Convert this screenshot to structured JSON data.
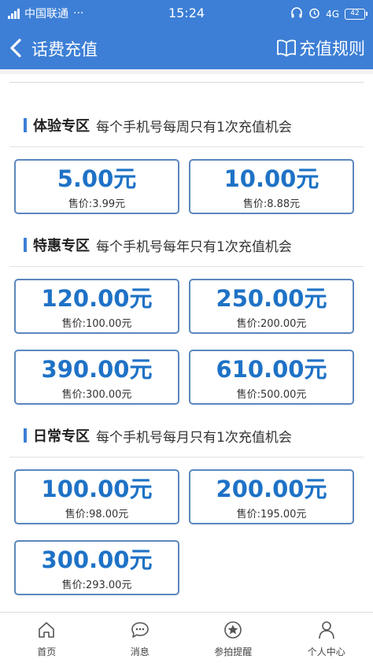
{
  "status_bar": {
    "carrier": "中国联通",
    "dots": "···",
    "time": "15:24",
    "network": "4G",
    "battery": "42"
  },
  "header": {
    "title": "话费充值",
    "rules_label": "充值规则",
    "color": "#3d7fd6"
  },
  "sections": [
    {
      "name": "体验专区",
      "desc": "每个手机号每周只有1次充值机会",
      "cards": [
        {
          "amount": "5.00元",
          "price": "售价:3.99元"
        },
        {
          "amount": "10.00元",
          "price": "售价:8.88元"
        }
      ]
    },
    {
      "name": "特惠专区",
      "desc": "每个手机号每年只有1次充值机会",
      "cards": [
        {
          "amount": "120.00元",
          "price": "售价:100.00元"
        },
        {
          "amount": "250.00元",
          "price": "售价:200.00元"
        },
        {
          "amount": "390.00元",
          "price": "售价:300.00元"
        },
        {
          "amount": "610.00元",
          "price": "售价:500.00元"
        }
      ]
    },
    {
      "name": "日常专区",
      "desc": "每个手机号每月只有1次充值机会",
      "cards": [
        {
          "amount": "100.00元",
          "price": "售价:98.00元"
        },
        {
          "amount": "200.00元",
          "price": "售价:195.00元"
        },
        {
          "amount": "300.00元",
          "price": "售价:293.00元"
        }
      ]
    }
  ],
  "tabs": [
    {
      "label": "首页",
      "icon": "home-icon"
    },
    {
      "label": "消息",
      "icon": "message-icon"
    },
    {
      "label": "参拍提醒",
      "icon": "star-badge-icon"
    },
    {
      "label": "个人中心",
      "icon": "person-icon"
    }
  ]
}
